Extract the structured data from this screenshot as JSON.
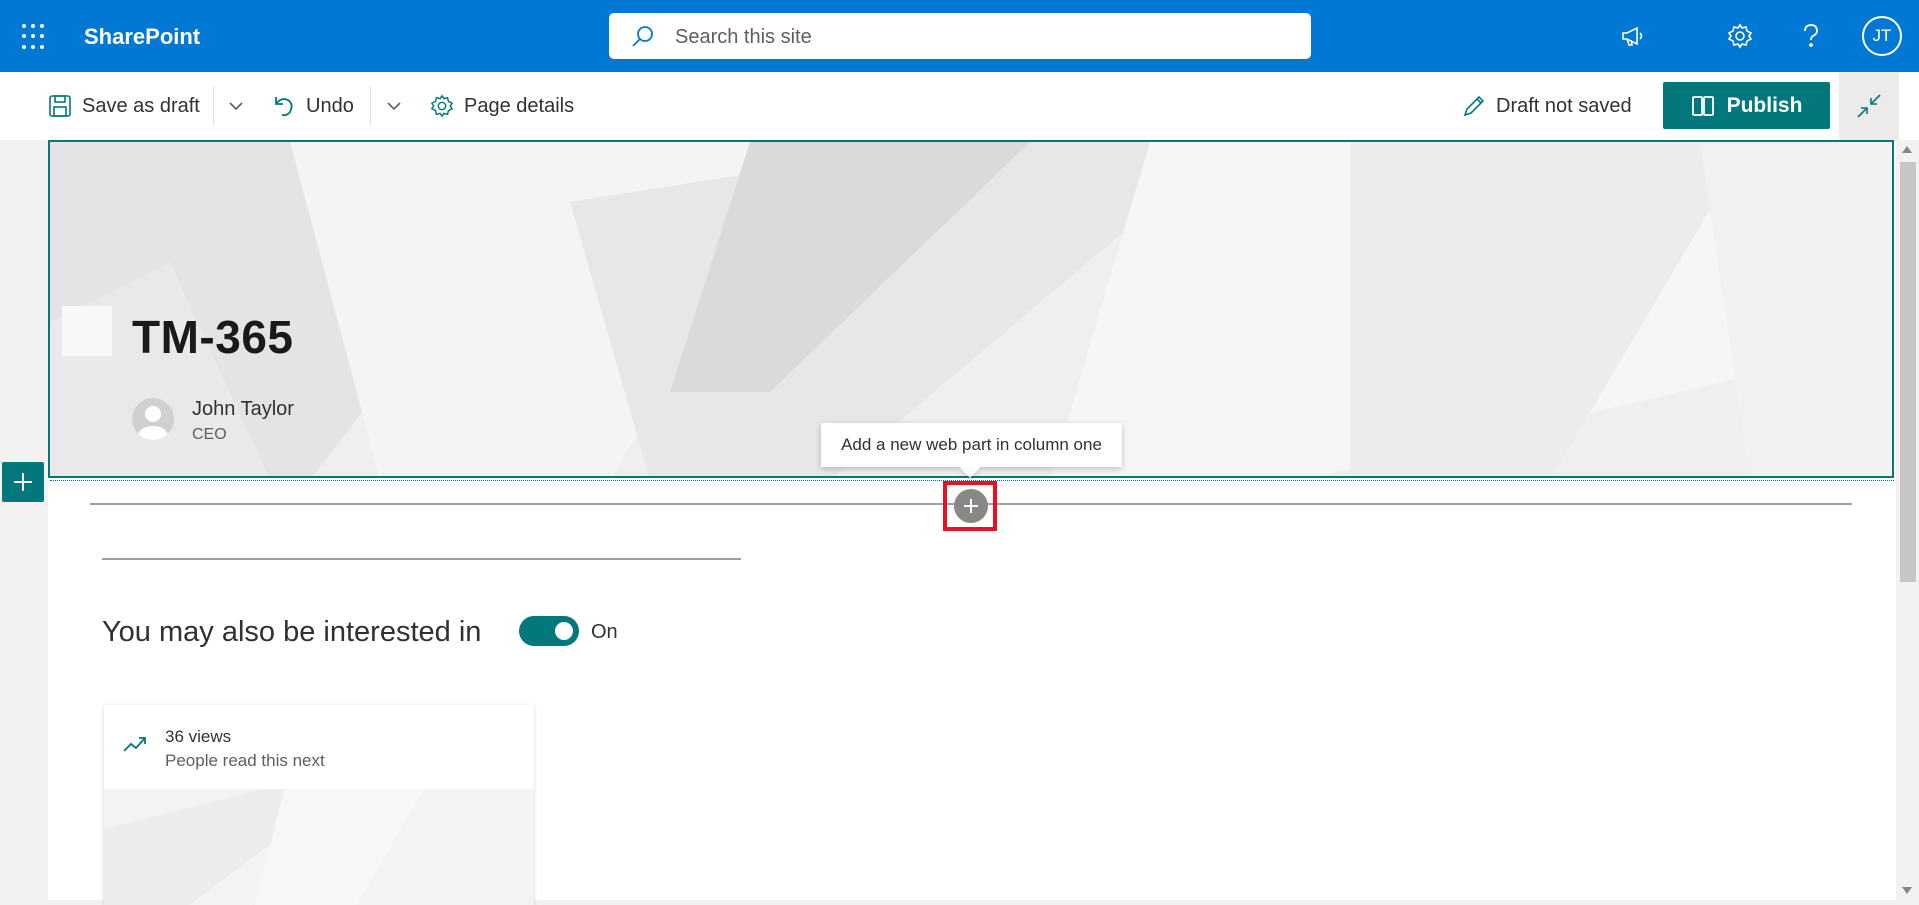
{
  "app": {
    "brand": "SharePoint",
    "colors": {
      "suite_bar": "#0078d4",
      "accent": "#03787c",
      "highlight": "#e81123"
    }
  },
  "search": {
    "placeholder": "Search this site"
  },
  "topbar": {
    "icons": [
      "app-launcher-icon",
      "megaphone-icon",
      "gear-icon",
      "help-icon"
    ],
    "avatar_initials": "JT"
  },
  "toolbar": {
    "save_label": "Save as draft",
    "undo_label": "Undo",
    "page_details_label": "Page details",
    "status": "Draft not saved",
    "publish_label": "Publish"
  },
  "page": {
    "title": "TM-365",
    "author": {
      "name": "John Taylor",
      "role": "CEO"
    }
  },
  "editor": {
    "tooltip": "Add a new web part in column one"
  },
  "related": {
    "heading": "You may also be interested in",
    "toggle_label": "On",
    "toggle_on": true,
    "card": {
      "views": "36 views",
      "subtitle": "People read this next"
    }
  }
}
